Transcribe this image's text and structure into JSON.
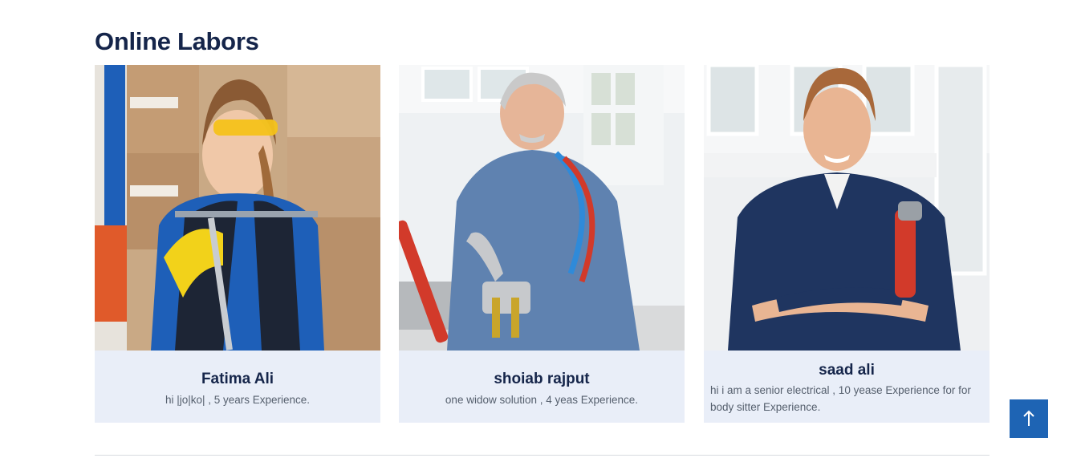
{
  "section": {
    "title": "Online Labors"
  },
  "labors": [
    {
      "name": "Fatima Ali",
      "description": "hi |jo|ko| , 5 years Experience.",
      "photo": "worker-photo-fatima"
    },
    {
      "name": "shoiab rajput",
      "description": "one widow solution , 4 yeas Experience.",
      "photo": "worker-photo-shoiab"
    },
    {
      "name": "saad ali",
      "description": "hi i am a senior electrical , 10 yease Experience for for body sitter Experience.",
      "photo": "worker-photo-saad"
    }
  ],
  "scroll_top": {
    "icon": "arrow-up-icon",
    "color": "#1e64b4"
  },
  "colors": {
    "title": "#15254a",
    "card_bg": "#e9eef8",
    "text_muted": "#555f6d"
  }
}
